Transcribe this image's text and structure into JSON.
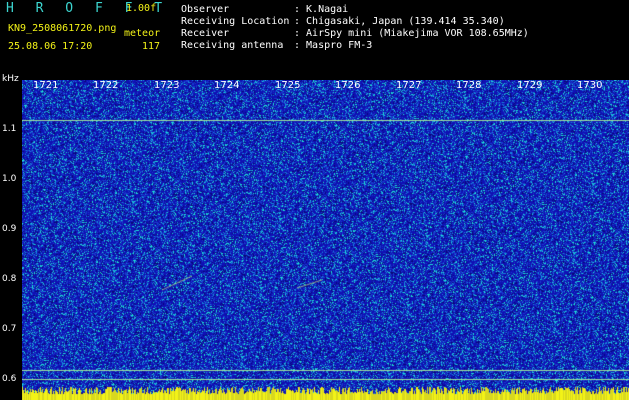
{
  "header": {
    "logo": "H R O F F T",
    "version": "1.00f",
    "filename": "KN9_2508061720.png",
    "mode": "meteor",
    "datetime": "25.08.06 17:20",
    "count": "117",
    "observer_label": "Observer",
    "observer_value": ": K.Nagai",
    "location_label": "Receiving Location",
    "location_value": ": Chigasaki, Japan (139.414 35.340)",
    "receiver_label": "Receiver",
    "receiver_value": ": AirSpy mini (Miakejima VOR 108.65MHz)",
    "antenna_label": "Receiving antenna",
    "antenna_value": ": Maspro FM-3"
  },
  "axes": {
    "y_unit": "kHz",
    "y_ticks": [
      "1.1",
      "1.0",
      "0.9",
      "0.8",
      "0.7",
      "0.6"
    ],
    "x_ticks": [
      "1721",
      "1722",
      "1723",
      "1724",
      "1725",
      "1726",
      "1727",
      "1728",
      "1729",
      "1730"
    ]
  },
  "colors": {
    "background": "#1010b4",
    "noise_high": "#1ee6d2",
    "line": "#9fe6a0",
    "bottom_bar": "#f3f317"
  }
}
